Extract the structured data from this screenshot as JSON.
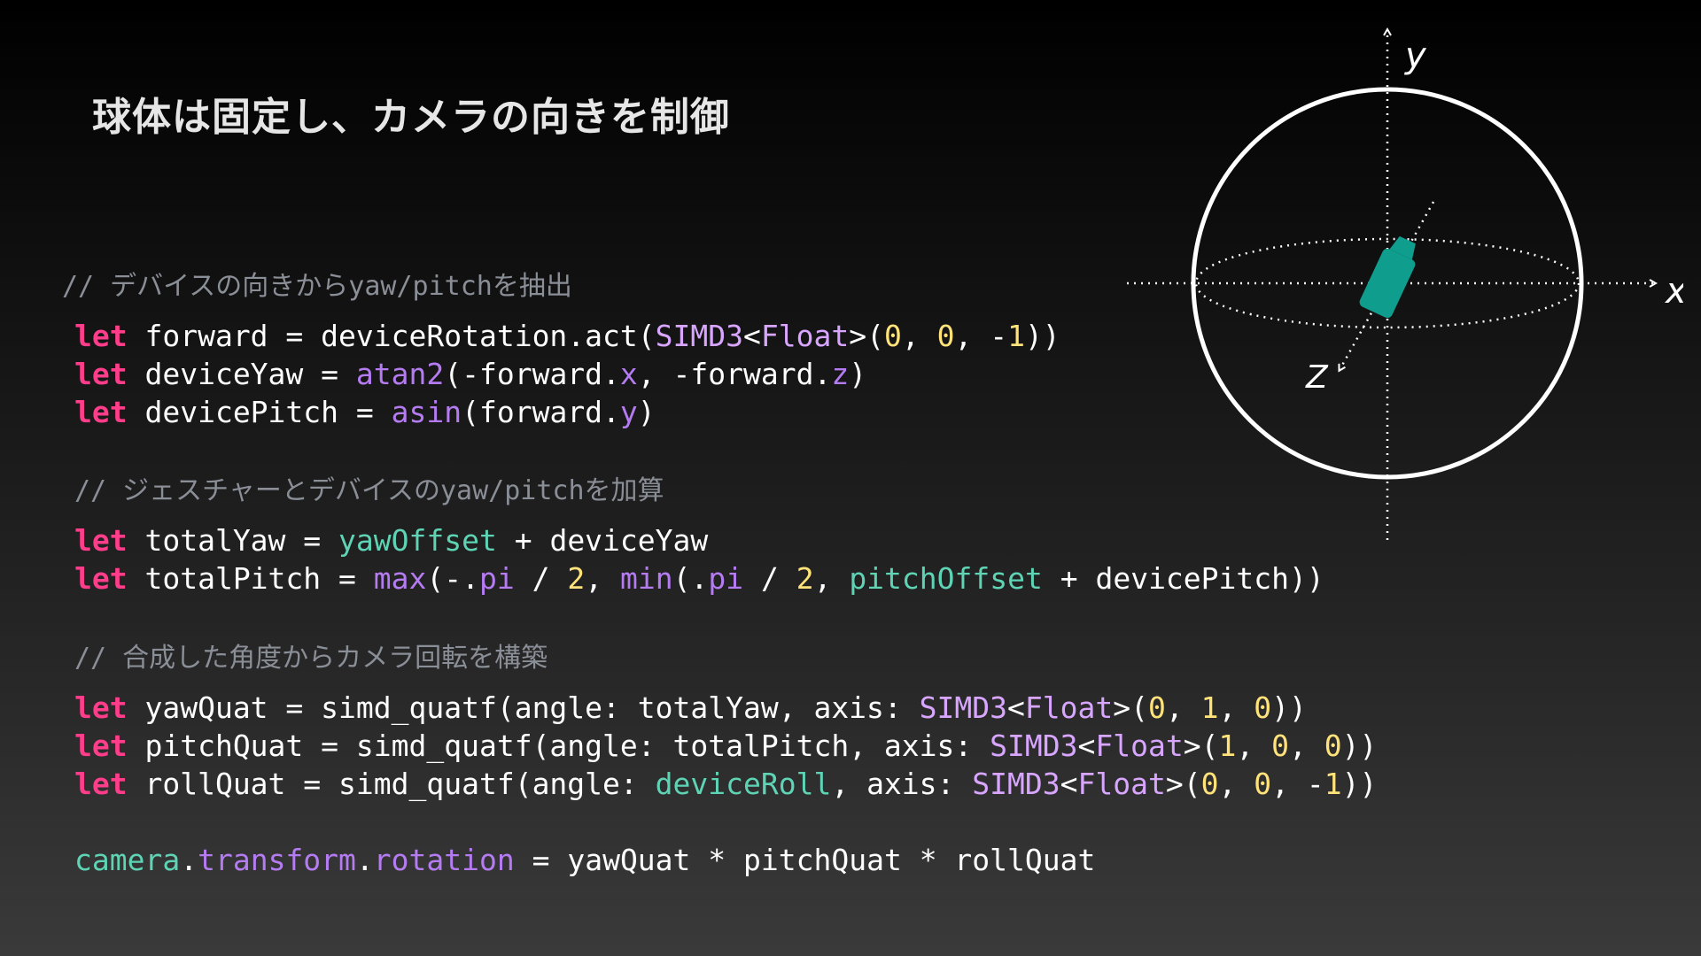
{
  "colors": {
    "keyword": "#ff3d8b",
    "type": "#d9a6ff",
    "number": "#ffe37a",
    "teal": "#5fd4b5",
    "purple": "#b57cf2",
    "comment": "#8a8e96",
    "plain": "#ffffff",
    "camera": "#0f9e8e"
  },
  "slide": {
    "title": "球体は固定し、カメラの向きを制御"
  },
  "code": {
    "comment1": "// デバイスの向きからyaw/pitchを抽出",
    "comment2": "// ジェスチャーとデバイスのyaw/pitchを加算",
    "comment3": "// 合成した角度からカメラ回転を構築",
    "lines": [
      [
        [
          "let",
          "keyword"
        ],
        [
          " forward = deviceRotation.act(",
          "plain"
        ],
        [
          "SIMD3",
          "type"
        ],
        [
          "<",
          "plain"
        ],
        [
          "Float",
          "type"
        ],
        [
          ">(",
          "plain"
        ],
        [
          "0",
          "number"
        ],
        [
          ", ",
          "plain"
        ],
        [
          "0",
          "number"
        ],
        [
          ", -",
          "plain"
        ],
        [
          "1",
          "number"
        ],
        [
          "))",
          "plain"
        ]
      ],
      [
        [
          "let",
          "keyword"
        ],
        [
          " deviceYaw = ",
          "plain"
        ],
        [
          "atan2",
          "purple"
        ],
        [
          "(-forward.",
          "plain"
        ],
        [
          "x",
          "purple"
        ],
        [
          ", -forward.",
          "plain"
        ],
        [
          "z",
          "purple"
        ],
        [
          ")",
          "plain"
        ]
      ],
      [
        [
          "let",
          "keyword"
        ],
        [
          " devicePitch = ",
          "plain"
        ],
        [
          "asin",
          "purple"
        ],
        [
          "(forward.",
          "plain"
        ],
        [
          "y",
          "purple"
        ],
        [
          ")",
          "plain"
        ]
      ],
      [
        [
          "let",
          "keyword"
        ],
        [
          " totalYaw = ",
          "plain"
        ],
        [
          "yawOffset",
          "teal"
        ],
        [
          " + deviceYaw",
          "plain"
        ]
      ],
      [
        [
          "let",
          "keyword"
        ],
        [
          " totalPitch = ",
          "plain"
        ],
        [
          "max",
          "purple"
        ],
        [
          "(-.",
          "plain"
        ],
        [
          "pi",
          "purple"
        ],
        [
          " / ",
          "plain"
        ],
        [
          "2",
          "number"
        ],
        [
          ", ",
          "plain"
        ],
        [
          "min",
          "purple"
        ],
        [
          "(.",
          "plain"
        ],
        [
          "pi",
          "purple"
        ],
        [
          " / ",
          "plain"
        ],
        [
          "2",
          "number"
        ],
        [
          ", ",
          "plain"
        ],
        [
          "pitchOffset",
          "teal"
        ],
        [
          " + devicePitch))",
          "plain"
        ]
      ],
      [
        [
          "let",
          "keyword"
        ],
        [
          " yawQuat = simd_quatf(angle: totalYaw, axis: ",
          "plain"
        ],
        [
          "SIMD3",
          "type"
        ],
        [
          "<",
          "plain"
        ],
        [
          "Float",
          "type"
        ],
        [
          ">(",
          "plain"
        ],
        [
          "0",
          "number"
        ],
        [
          ", ",
          "plain"
        ],
        [
          "1",
          "number"
        ],
        [
          ", ",
          "plain"
        ],
        [
          "0",
          "number"
        ],
        [
          "))",
          "plain"
        ]
      ],
      [
        [
          "let",
          "keyword"
        ],
        [
          " pitchQuat = simd_quatf(angle: totalPitch, axis: ",
          "plain"
        ],
        [
          "SIMD3",
          "type"
        ],
        [
          "<",
          "plain"
        ],
        [
          "Float",
          "type"
        ],
        [
          ">(",
          "plain"
        ],
        [
          "1",
          "number"
        ],
        [
          ", ",
          "plain"
        ],
        [
          "0",
          "number"
        ],
        [
          ", ",
          "plain"
        ],
        [
          "0",
          "number"
        ],
        [
          "))",
          "plain"
        ]
      ],
      [
        [
          "let",
          "keyword"
        ],
        [
          " rollQuat = simd_quatf(angle: ",
          "plain"
        ],
        [
          "deviceRoll",
          "teal"
        ],
        [
          ", axis: ",
          "plain"
        ],
        [
          "SIMD3",
          "type"
        ],
        [
          "<",
          "plain"
        ],
        [
          "Float",
          "type"
        ],
        [
          ">(",
          "plain"
        ],
        [
          "0",
          "number"
        ],
        [
          ", ",
          "plain"
        ],
        [
          "0",
          "number"
        ],
        [
          ", -",
          "plain"
        ],
        [
          "1",
          "number"
        ],
        [
          "))",
          "plain"
        ]
      ],
      [
        [
          "camera",
          "teal"
        ],
        [
          ".",
          "plain"
        ],
        [
          "transform",
          "purple"
        ],
        [
          ".",
          "plain"
        ],
        [
          "rotation",
          "purple"
        ],
        [
          " = yawQuat * pitchQuat * rollQuat",
          "plain"
        ]
      ]
    ]
  },
  "diagram": {
    "x_label": "x",
    "y_label": "y",
    "z_label": "Z"
  }
}
